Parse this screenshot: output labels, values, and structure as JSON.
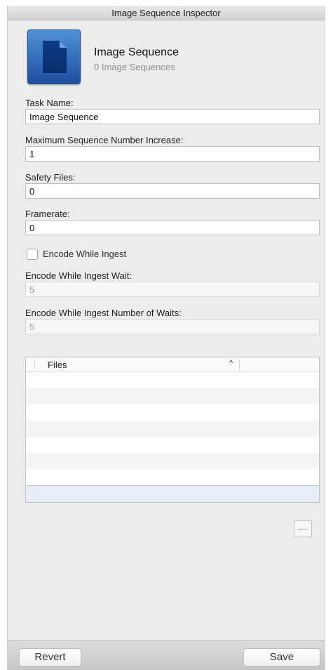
{
  "window": {
    "title": "Image Sequence Inspector"
  },
  "header": {
    "title": "Image Sequence",
    "subtitle": "0 Image Sequences",
    "icon": "document-icon"
  },
  "form": {
    "task_name": {
      "label": "Task Name:",
      "value": "Image Sequence"
    },
    "max_seq_increase": {
      "label": "Maximum Sequence Number Increase:",
      "value": "1"
    },
    "safety_files": {
      "label": "Safety Files:",
      "value": "0"
    },
    "framerate": {
      "label": "Framerate:",
      "value": "0"
    },
    "encode_while_ingest": {
      "label": "Encode While Ingest",
      "checked": false
    },
    "encode_wait": {
      "label": "Encode While Ingest Wait:",
      "value": "5"
    },
    "encode_num_waits": {
      "label": "Encode While Ingest Number of Waits:",
      "value": "5"
    }
  },
  "files_table": {
    "column": "Files",
    "sort_icon": "^",
    "rows": []
  },
  "remove_button": {
    "label": "—"
  },
  "footer": {
    "revert_label": "Revert",
    "save_label": "Save"
  }
}
